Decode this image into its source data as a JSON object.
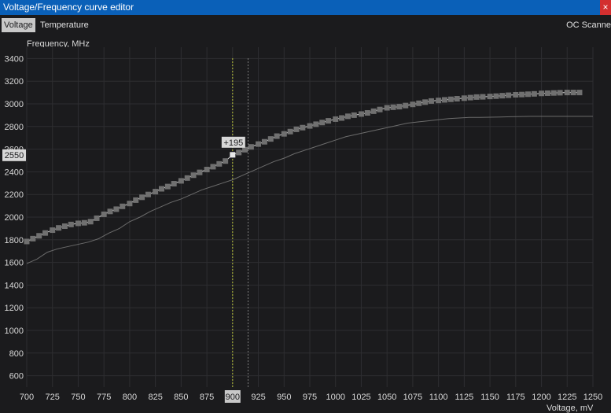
{
  "window": {
    "title": "Voltage/Frequency curve editor",
    "close_glyph": "×"
  },
  "tabs": [
    {
      "label": "Voltage",
      "active": true
    },
    {
      "label": "Temperature",
      "active": false
    }
  ],
  "oc_scanner": "OC Scanne",
  "colors": {
    "titlebar": "#0a60b8",
    "background": "#1b1b1d",
    "grid": "#2e2e31",
    "curve_point": "#707070",
    "curve_line": "#d8d8d8",
    "base_line": "#6c6c6c",
    "cursor_voltage": "#b8c23a",
    "cursor_marker": "#8a8a8a"
  },
  "chart_data": {
    "type": "line",
    "ylabel": "Frequency, MHz",
    "xlabel": "Voltage, mV",
    "xlim": [
      700,
      1250
    ],
    "ylim": [
      500,
      3500
    ],
    "xticks": [
      700,
      725,
      750,
      775,
      800,
      825,
      850,
      875,
      900,
      925,
      950,
      975,
      1000,
      1025,
      1050,
      1075,
      1100,
      1125,
      1150,
      1175,
      1200,
      1225,
      1250
    ],
    "yticks": [
      600,
      800,
      1000,
      1200,
      1400,
      1600,
      1800,
      2000,
      2200,
      2400,
      2600,
      2800,
      3000,
      3200,
      3400
    ],
    "grid": true,
    "series": [
      {
        "role": "adjusted-curve",
        "x": [
          700,
          706,
          712,
          718,
          725,
          731,
          737,
          743,
          750,
          756,
          762,
          768,
          775,
          781,
          787,
          793,
          800,
          806,
          812,
          818,
          825,
          831,
          837,
          843,
          850,
          856,
          862,
          868,
          875,
          881,
          887,
          893,
          900,
          906,
          912,
          918,
          925,
          931,
          937,
          943,
          950,
          956,
          962,
          968,
          975,
          981,
          987,
          993,
          1000,
          1006,
          1012,
          1018,
          1025,
          1031,
          1037,
          1043,
          1050,
          1056,
          1062,
          1068,
          1075,
          1081,
          1087,
          1093,
          1100,
          1106,
          1112,
          1118,
          1125,
          1131,
          1137,
          1143,
          1150,
          1156,
          1162,
          1168,
          1175,
          1181,
          1187,
          1193,
          1200,
          1206,
          1212,
          1218,
          1225,
          1231,
          1237
        ],
        "y": [
          1785,
          1810,
          1835,
          1860,
          1885,
          1905,
          1920,
          1935,
          1945,
          1950,
          1960,
          1990,
          2025,
          2050,
          2070,
          2095,
          2120,
          2150,
          2175,
          2200,
          2225,
          2250,
          2270,
          2295,
          2320,
          2345,
          2370,
          2395,
          2420,
          2445,
          2470,
          2495,
          2550,
          2570,
          2595,
          2620,
          2645,
          2665,
          2690,
          2715,
          2735,
          2755,
          2775,
          2790,
          2805,
          2820,
          2835,
          2850,
          2865,
          2875,
          2890,
          2900,
          2910,
          2920,
          2935,
          2950,
          2965,
          2970,
          2975,
          2985,
          2995,
          3005,
          3015,
          3025,
          3030,
          3035,
          3040,
          3045,
          3050,
          3055,
          3060,
          3062,
          3065,
          3068,
          3072,
          3076,
          3080,
          3082,
          3085,
          3088,
          3092,
          3094,
          3096,
          3098,
          3100,
          3100,
          3100
        ]
      },
      {
        "role": "default-curve",
        "x": [
          700,
          710,
          720,
          730,
          740,
          750,
          760,
          770,
          780,
          790,
          800,
          810,
          820,
          830,
          840,
          850,
          860,
          870,
          880,
          890,
          900,
          910,
          920,
          930,
          940,
          950,
          960,
          970,
          980,
          990,
          1000,
          1010,
          1020,
          1030,
          1040,
          1050,
          1060,
          1070,
          1080,
          1090,
          1100,
          1110,
          1120,
          1130,
          1140,
          1150,
          1160,
          1170,
          1180,
          1190,
          1200,
          1210,
          1220,
          1230,
          1240,
          1250
        ],
        "y": [
          1590,
          1630,
          1690,
          1720,
          1740,
          1760,
          1780,
          1810,
          1860,
          1900,
          1960,
          2000,
          2050,
          2090,
          2130,
          2160,
          2200,
          2240,
          2270,
          2300,
          2330,
          2370,
          2410,
          2450,
          2490,
          2520,
          2560,
          2590,
          2620,
          2650,
          2680,
          2710,
          2730,
          2750,
          2770,
          2790,
          2810,
          2830,
          2840,
          2850,
          2860,
          2870,
          2875,
          2880,
          2880,
          2882,
          2884,
          2886,
          2888,
          2890,
          2890,
          2890,
          2890,
          2890,
          2890,
          2890
        ]
      }
    ],
    "cursor": {
      "voltage": 900,
      "frequency": 2550,
      "offset_label": "+195"
    },
    "reference_line_x": 915
  }
}
